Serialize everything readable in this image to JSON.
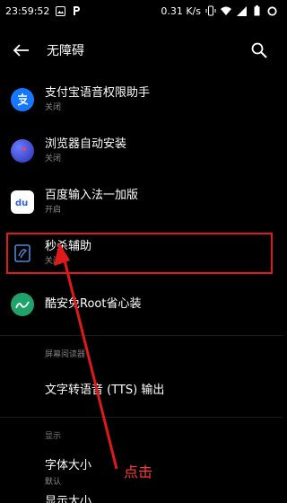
{
  "status": {
    "time": "23:59:52",
    "speed": "0.31 K/s"
  },
  "appbar": {
    "title": "无障碍"
  },
  "items": [
    {
      "name": "支付宝语音权限助手",
      "state": "关闭"
    },
    {
      "name": "浏览器自动安装",
      "state": "关闭"
    },
    {
      "name": "百度输入法一加版",
      "state": "开启"
    },
    {
      "name": "秒杀辅助",
      "state": "关闭"
    },
    {
      "name": "酷安免Root省心装",
      "state": ""
    }
  ],
  "sections": {
    "screen_reader": "屏幕阅读器",
    "display": "显示"
  },
  "tts": "文字转语音 (TTS) 输出",
  "font_size": {
    "name": "字体大小",
    "state": "默认"
  },
  "cut_item": "显示大小",
  "annotation": "点击",
  "colors": {
    "alipay": "#1678ff",
    "browser": "#3b4cd6",
    "baidu": "#ffffff",
    "seckill": "#2a5aa8",
    "coolapk": "#1fa36b",
    "highlight": "#e01a1a"
  }
}
